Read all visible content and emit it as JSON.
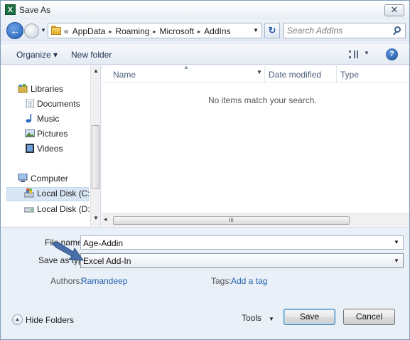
{
  "window": {
    "title": "Save As",
    "app_icon_letter": "X",
    "close_label": "✕"
  },
  "address": {
    "lead_chevron": "«",
    "crumbs": [
      "AppData",
      "Roaming",
      "Microsoft",
      "AddIns"
    ],
    "separator": "▸"
  },
  "search": {
    "placeholder": "Search AddIns"
  },
  "toolbar": {
    "organize_label": "Organize ▾",
    "new_folder_label": "New folder",
    "help_label": "?"
  },
  "nav": {
    "libraries": "Libraries",
    "documents": "Documents",
    "music": "Music",
    "pictures": "Pictures",
    "videos": "Videos",
    "computer": "Computer",
    "local_disk_c": "Local Disk (C:)",
    "local_disk_d": "Local Disk (D:)"
  },
  "file_list": {
    "columns": [
      "Name",
      "Date modified",
      "Type"
    ],
    "empty_message": "No items match your search.",
    "scroll_grip": "III"
  },
  "form": {
    "file_name_label": "File name:",
    "file_name_value": "Age-Addin",
    "save_as_type_label": "Save as type:",
    "save_as_type_value": "Excel Add-In",
    "authors_label": "Authors:",
    "authors_value": "Ramandeep",
    "tags_label": "Tags:",
    "tags_value": "Add a tag"
  },
  "footer": {
    "hide_folders_label": "Hide Folders",
    "tools_label": "Tools",
    "save_label": "Save",
    "cancel_label": "Cancel"
  },
  "colors": {
    "accent": "#1f5fb0",
    "excel_green": "#1e7145",
    "annotation_arrow": "#4a6fa8"
  }
}
